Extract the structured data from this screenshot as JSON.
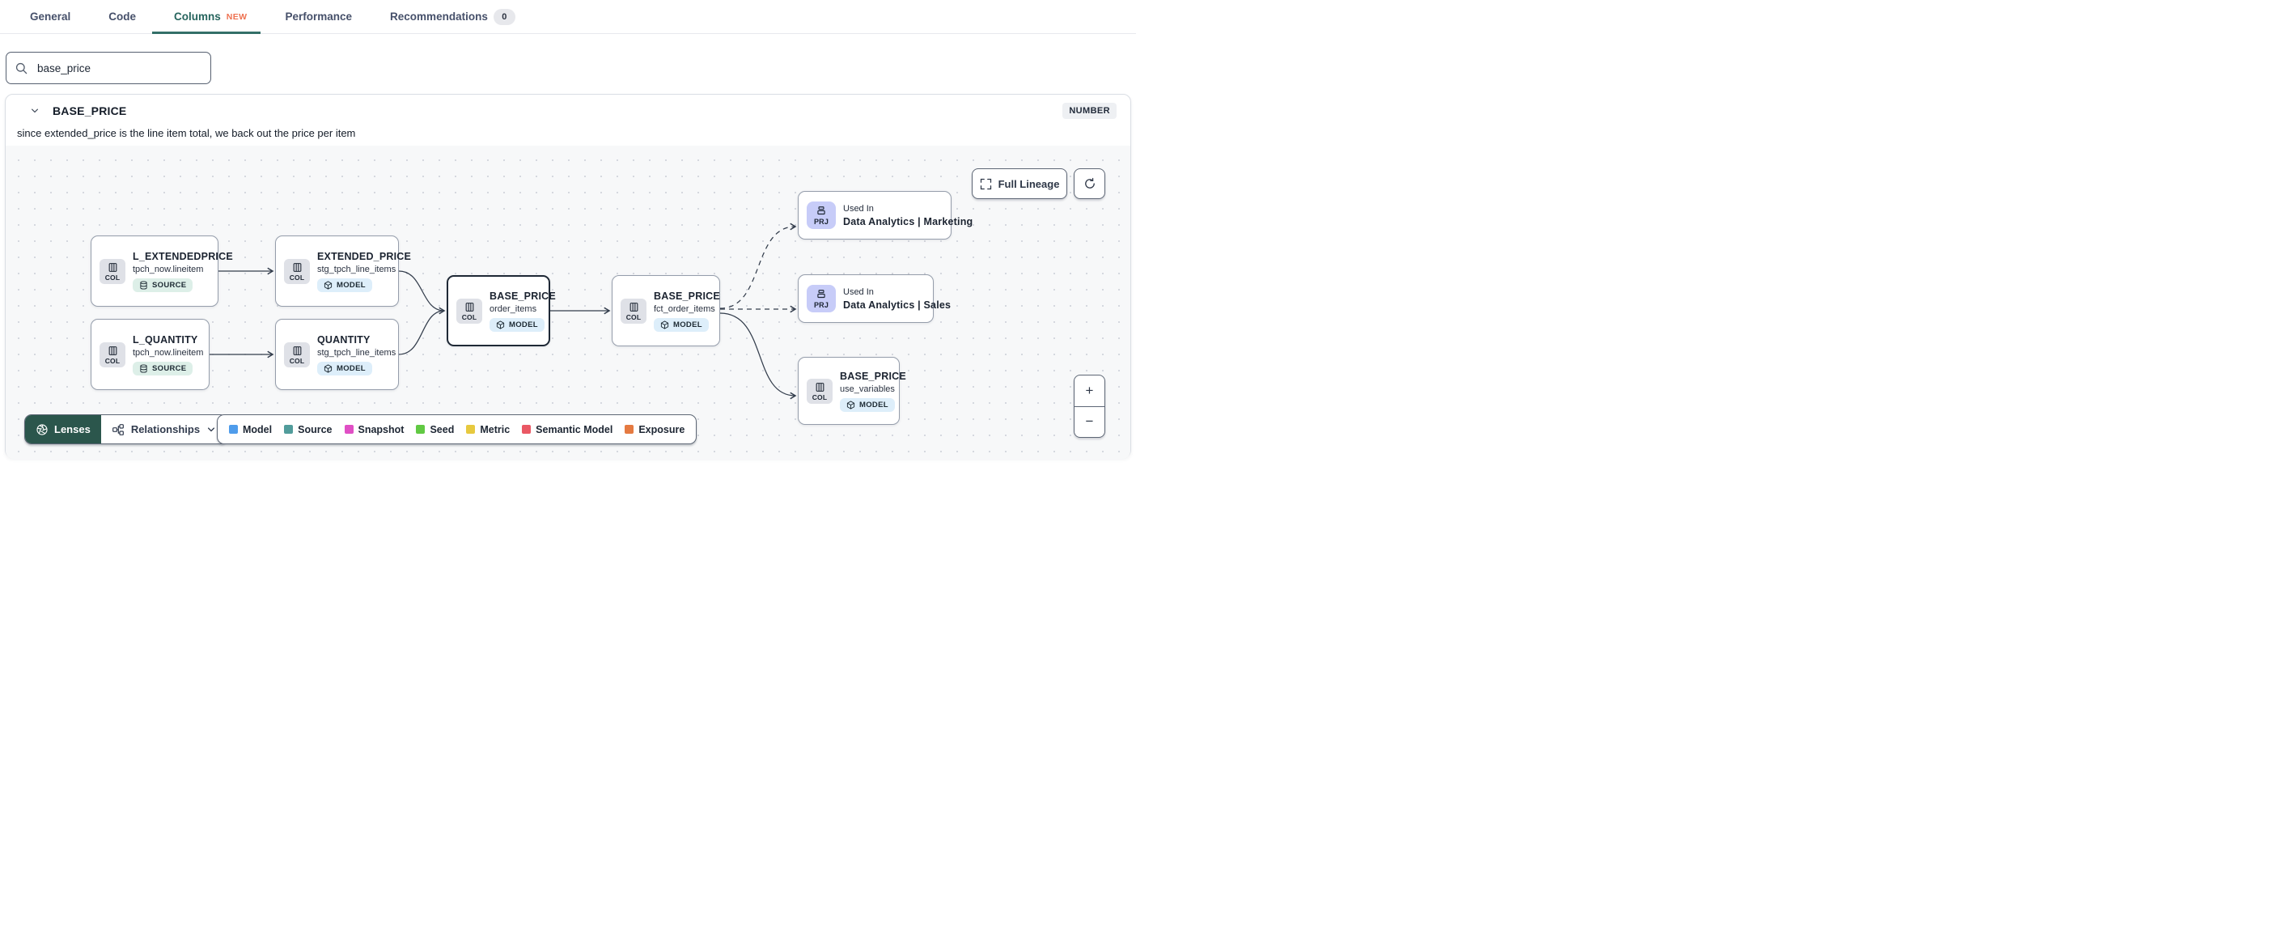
{
  "tabs": {
    "items": [
      {
        "label": "General"
      },
      {
        "label": "Code"
      },
      {
        "label": "Columns",
        "badge": "NEW",
        "active": true
      },
      {
        "label": "Performance"
      },
      {
        "label": "Recommendations",
        "count": "0"
      }
    ]
  },
  "search": {
    "value": "base_price"
  },
  "column": {
    "name": "BASE_PRICE",
    "data_type": "NUMBER",
    "description": "since extended_price is the line item total, we back out the price per item"
  },
  "lineage": {
    "full_lineage_label": "Full Lineage",
    "nodes": [
      {
        "chip": "COL",
        "title": "L_EXTENDEDPRICE",
        "subtitle": "tpch_now.lineitem",
        "badge": "SOURCE"
      },
      {
        "chip": "COL",
        "title": "EXTENDED_PRICE",
        "subtitle": "stg_tpch_line_items",
        "badge": "MODEL"
      },
      {
        "chip": "COL",
        "title": "L_QUANTITY",
        "subtitle": "tpch_now.lineitem",
        "badge": "SOURCE"
      },
      {
        "chip": "COL",
        "title": "QUANTITY",
        "subtitle": "stg_tpch_line_items",
        "badge": "MODEL"
      },
      {
        "chip": "COL",
        "title": "BASE_PRICE",
        "subtitle": "order_items",
        "badge": "MODEL",
        "selected": true
      },
      {
        "chip": "COL",
        "title": "BASE_PRICE",
        "subtitle": "fct_order_items",
        "badge": "MODEL"
      },
      {
        "chip": "PRJ",
        "eyebrow": "Used In",
        "title": "Data Analytics | Marketing"
      },
      {
        "chip": "PRJ",
        "eyebrow": "Used In",
        "title": "Data Analytics | Sales"
      },
      {
        "chip": "COL",
        "title": "BASE_PRICE",
        "subtitle": "use_variables",
        "badge": "MODEL"
      }
    ],
    "toolbar": {
      "lenses": "Lenses",
      "relationships": "Relationships"
    },
    "legend": [
      {
        "label": "Model",
        "color": "#4f9ceb"
      },
      {
        "label": "Source",
        "color": "#519c9b"
      },
      {
        "label": "Snapshot",
        "color": "#e04fc5"
      },
      {
        "label": "Seed",
        "color": "#61c943"
      },
      {
        "label": "Metric",
        "color": "#e7c93f"
      },
      {
        "label": "Semantic Model",
        "color": "#ea5864"
      },
      {
        "label": "Exposure",
        "color": "#e57a41"
      }
    ],
    "zoom": {
      "in": "+",
      "out": "−"
    }
  },
  "colors": {
    "accent_teal": "#2c6e67",
    "lenses_bg": "#2b564c",
    "new_badge": "#ee7150"
  }
}
